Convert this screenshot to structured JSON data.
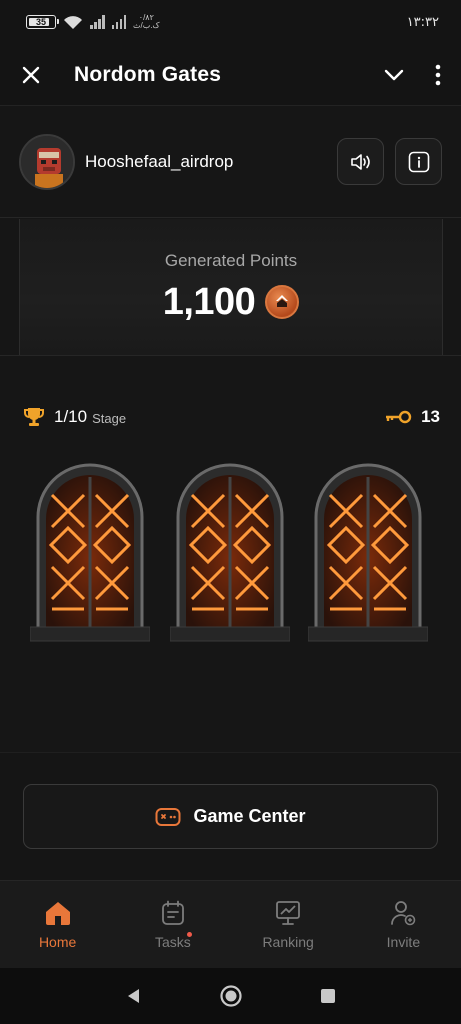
{
  "status_bar": {
    "battery": "35",
    "speed": "۰/۸۲\nک.ب/ث",
    "time": "۱۳:۳۲"
  },
  "header": {
    "title": "Nordom Gates",
    "close_icon": "close-icon",
    "dropdown_icon": "chevron-down-icon",
    "menu_icon": "more-vertical-icon"
  },
  "profile": {
    "username": "Hooshefaal_airdrop",
    "sound_icon": "speaker-icon",
    "info_icon": "info-icon"
  },
  "points": {
    "label": "Generated Points",
    "value": "1,100"
  },
  "stage": {
    "value": "1/10",
    "label": "Stage",
    "keys": "13"
  },
  "gates": [
    "gate-1",
    "gate-2",
    "gate-3"
  ],
  "game_center": {
    "label": "Game Center"
  },
  "nav": [
    {
      "label": "Home",
      "icon": "home-icon",
      "active": true
    },
    {
      "label": "Tasks",
      "icon": "tasks-icon",
      "active": false,
      "badge": true
    },
    {
      "label": "Ranking",
      "icon": "ranking-icon",
      "active": false
    },
    {
      "label": "Invite",
      "icon": "invite-icon",
      "active": false
    }
  ],
  "colors": {
    "accent": "#e8773a",
    "background": "#161616",
    "badge": "#f05a4a"
  }
}
